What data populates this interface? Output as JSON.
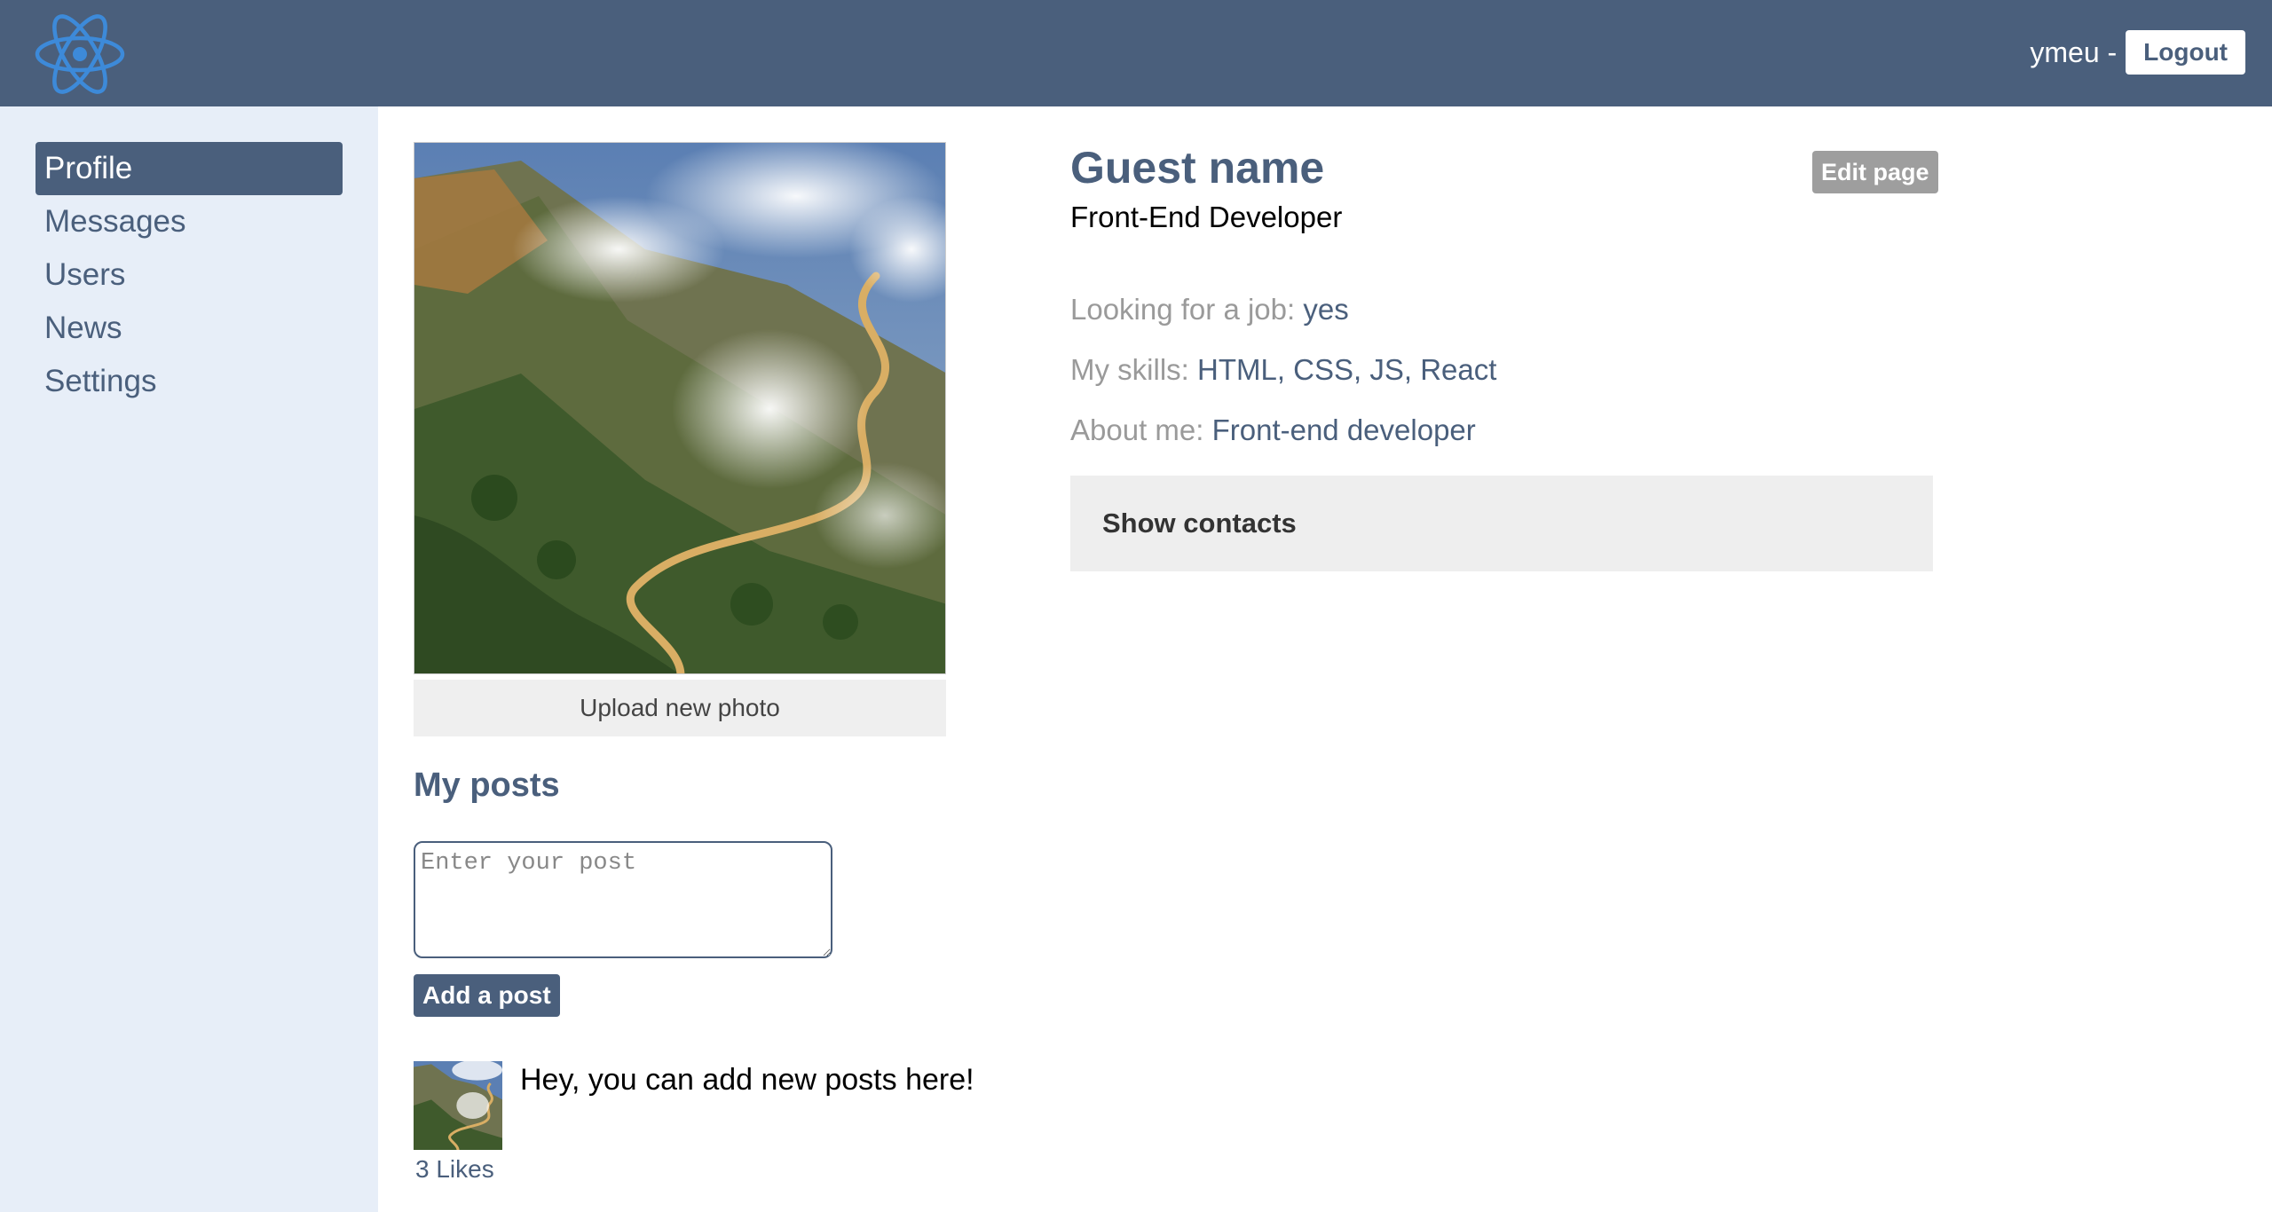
{
  "header": {
    "logo_icon": "react-atom-icon",
    "username": "ymeu -",
    "logout_label": "Logout"
  },
  "sidebar": {
    "items": [
      {
        "label": "Profile",
        "active": true
      },
      {
        "label": "Messages",
        "active": false
      },
      {
        "label": "Users",
        "active": false
      },
      {
        "label": "News",
        "active": false
      },
      {
        "label": "Settings",
        "active": false
      }
    ]
  },
  "profile": {
    "name": "Guest name",
    "role": "Front-End Developer",
    "edit_label": "Edit page",
    "upload_label": "Upload new photo",
    "job_label": "Looking for a job: ",
    "job_value": "yes",
    "skills_label": "My skills: ",
    "skills_value": "HTML, CSS, JS, React",
    "about_label": "About me: ",
    "about_value": "Front-end developer",
    "contacts_label": "Show contacts"
  },
  "posts": {
    "title": "My posts",
    "input_placeholder": "Enter your post",
    "add_label": "Add a post",
    "items": [
      {
        "text": "Hey, you can add new posts here!",
        "likes": "3 Likes"
      }
    ]
  },
  "colors": {
    "header_bg": "#4a5f7c",
    "sidebar_bg": "#e7eef8",
    "accent": "#4a5f7c",
    "logo": "#3d8ad9"
  }
}
